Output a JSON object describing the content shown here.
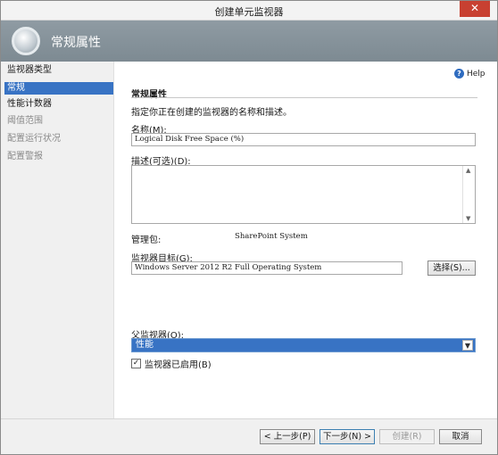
{
  "window": {
    "title": "创建单元监视器",
    "close_glyph": "✕"
  },
  "header": {
    "title": "常规属性"
  },
  "nav": {
    "items": [
      {
        "label": "监视器类型",
        "state": "normal"
      },
      {
        "label": "常规",
        "state": "selected"
      },
      {
        "label": "性能计数器",
        "state": "normal"
      },
      {
        "label": "阈值范围",
        "state": "disabled"
      },
      {
        "label": "配置运行状况",
        "state": "disabled"
      },
      {
        "label": "配置警报",
        "state": "disabled"
      }
    ]
  },
  "help": {
    "label": "Help",
    "icon": "?"
  },
  "form": {
    "section_title": "常规属性",
    "description": "指定你正在创建的监视器的名称和描述。",
    "name_label": "名称(M):",
    "name_value": "Logical Disk Free Space (%)",
    "desc_label": "描述(可选)(D):",
    "desc_value": "",
    "mp_label": "管理包:",
    "mp_value": "SharePoint System",
    "target_label": "监视器目标(G):",
    "target_value": "Windows Server 2012 R2 Full Operating System",
    "select_button": "选择(S)...",
    "parent_label": "父监视器(O):",
    "parent_value": "性能",
    "enabled_label": "监视器已启用(B)",
    "enabled_checked": "✓"
  },
  "footer": {
    "prev": "< 上一步(P)",
    "next": "下一步(N) >",
    "create": "创建(R)",
    "cancel": "取消"
  },
  "colors": {
    "accent": "#3873c4",
    "header": "#8a969e",
    "close": "#c84031"
  }
}
